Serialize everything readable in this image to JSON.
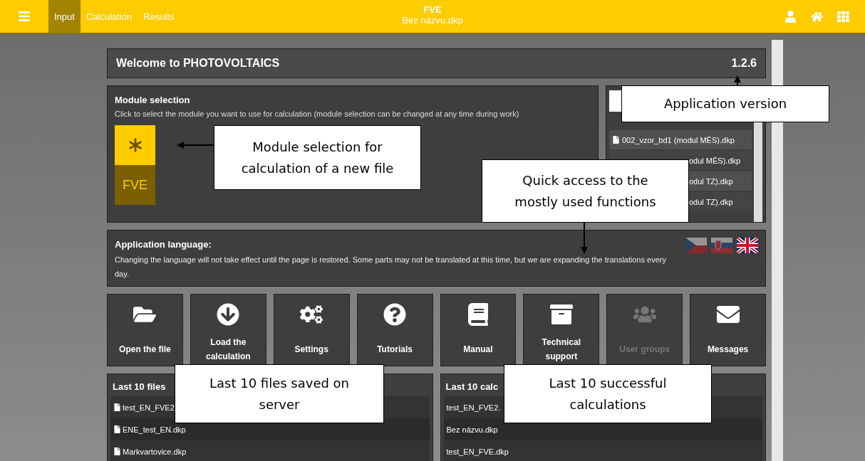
{
  "header": {
    "tabs": [
      {
        "label": "Input",
        "selected": true
      },
      {
        "label": "Calculation",
        "selected": false
      },
      {
        "label": "Results",
        "selected": false
      }
    ],
    "title": "FVE",
    "subtitle": "Bez názvu.dkp"
  },
  "welcome": {
    "title": "Welcome to PHOTOVOLTAICS",
    "version": "1.2.6"
  },
  "module_selection": {
    "title": "Module selection",
    "hint": "Click to select the module you want to use for calculation (module selection can be changed at any time during work)",
    "module_label": "FVE"
  },
  "recent_files": [
    {
      "name": "002_vzor_bd1 (modul MĚS).dkp",
      "kind": "full"
    },
    {
      "name": "odul MĚS).dkp",
      "kind": "partial"
    },
    {
      "name": "odul TZ).dkp",
      "kind": "partial"
    },
    {
      "name": "odul TZ).dkp",
      "kind": "partial"
    }
  ],
  "language": {
    "title": "Application language:",
    "text": "Changing the language will not take effect until the page is restored. Some parts may not be translated at this time, but we are expanding the translations every day.",
    "flags": [
      {
        "kind": "cz",
        "selected": false
      },
      {
        "kind": "sk",
        "selected": false
      },
      {
        "kind": "uk",
        "selected": true
      }
    ]
  },
  "actions": [
    {
      "kind": "open",
      "label": "Open the file",
      "disabled": false
    },
    {
      "kind": "load",
      "label": "Load the calculation",
      "disabled": false
    },
    {
      "kind": "settings",
      "label": "Settings",
      "disabled": false
    },
    {
      "kind": "tutorials",
      "label": "Tutorials",
      "disabled": false
    },
    {
      "kind": "manual",
      "label": "Manual",
      "disabled": false
    },
    {
      "kind": "support",
      "label": "Technical support",
      "disabled": false
    },
    {
      "kind": "groups",
      "label": "User groups",
      "disabled": true
    },
    {
      "kind": "messages",
      "label": "Messages",
      "disabled": false
    }
  ],
  "last_files": {
    "title": "Last 10 files",
    "rows": [
      "test_EN_FVE2",
      "ENE_test_EN.dkp",
      "Markvartovice.dkp"
    ]
  },
  "last_calculations": {
    "title": "Last 10 calc",
    "rows": [
      "test_EN_FVE2.",
      "Bez názvu.dkp",
      "test_EN_FVE.dkp"
    ]
  },
  "callouts": [
    "Application version",
    "Module selection for calculation of a new file",
    "Quick access to the mostly used functions",
    "Last 10 files saved on server",
    "Last 10 successful calculations"
  ]
}
